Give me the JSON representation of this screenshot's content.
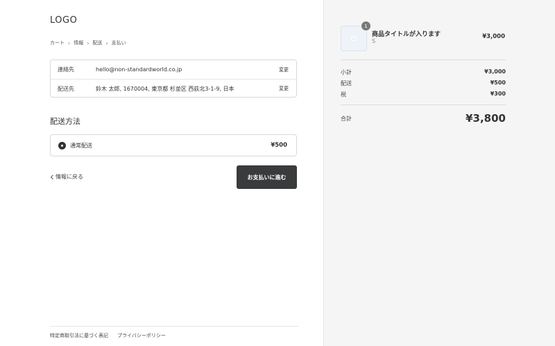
{
  "header": {
    "logo": "LOGO"
  },
  "breadcrumb": {
    "items": [
      "カート",
      "情報",
      "配送",
      "支払い"
    ],
    "separator": "›"
  },
  "contact": {
    "rows": [
      {
        "label": "連絡先",
        "value": "hello@non-standardworld.co.jp",
        "change": "変更"
      },
      {
        "label": "配送先",
        "value": "鈴木 太郎, 1670004, 東京都 杉並区 西荻北3-1-9, 日本",
        "change": "変更"
      }
    ]
  },
  "shipping": {
    "title": "配送方法",
    "option": {
      "name": "通常配送",
      "price": "¥500",
      "selected": true
    }
  },
  "nav": {
    "back": "情報に戻る",
    "back_icon": "chevron-left-icon",
    "continue": "お支払いに進む"
  },
  "footer": {
    "links": [
      "特定商取引法に基づく表記",
      "プライバシーポリシー"
    ]
  },
  "summary": {
    "product": {
      "title": "商品タイトルが入ります",
      "variant": "S",
      "price": "¥3,000",
      "quantity": "1",
      "thumb_icon": "image-placeholder-icon"
    },
    "lines": [
      {
        "label": "小計",
        "value": "¥3,000"
      },
      {
        "label": "配送",
        "value": "¥500"
      },
      {
        "label": "税",
        "value": "¥300"
      }
    ],
    "total": {
      "label": "合計",
      "value": "¥3,800"
    }
  },
  "colors": {
    "button_bg": "#3a3b3d",
    "sidebar_bg": "#f5f5f5"
  }
}
